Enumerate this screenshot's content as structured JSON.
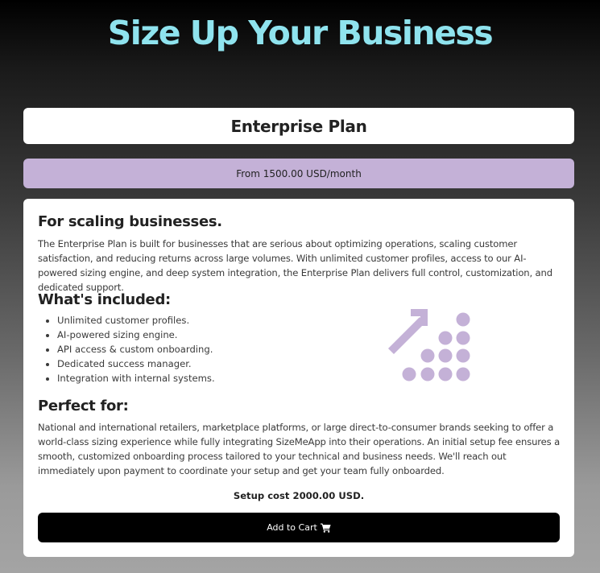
{
  "hero": {
    "title": "Size Up Your Business"
  },
  "plan": {
    "name": "Enterprise Plan",
    "price": "From 1500.00 USD/month"
  },
  "details": {
    "tagline": "For scaling businesses.",
    "description": "The Enterprise Plan is built for businesses that are serious about optimizing operations, scaling customer satisfaction, and reducing returns across large volumes. With unlimited customer profiles, access to our AI-powered sizing engine, and deep system integration, the Enterprise Plan delivers full control, customization, and dedicated support.",
    "included_heading": "What's included:",
    "features": [
      "Unlimited customer profiles.",
      "AI-powered sizing engine.",
      "API access & custom onboarding.",
      "Dedicated success manager.",
      "Integration with internal systems."
    ],
    "perfect_heading": "Perfect for:",
    "perfect_text": "National and international retailers, marketplace platforms, or large direct-to-consumer brands seeking to offer a world-class sizing experience while fully integrating SizeMeApp into their operations. An initial setup fee ensures a smooth, customized onboarding process tailored to your technical and business needs. We'll reach out immediately upon payment to coordinate your setup and get your team fully onboarded.",
    "setup_cost": "Setup cost 2000.00 USD.",
    "illustration_icon": "growth-arrow-dots-icon"
  },
  "cart_button": {
    "label": "Add to Cart",
    "icon": "shopping-cart-icon"
  },
  "colors": {
    "title_accent": "#8fe3ee",
    "price_band": "#c4b1d7",
    "illustration": "#c4b1d7",
    "button": "#000000"
  }
}
